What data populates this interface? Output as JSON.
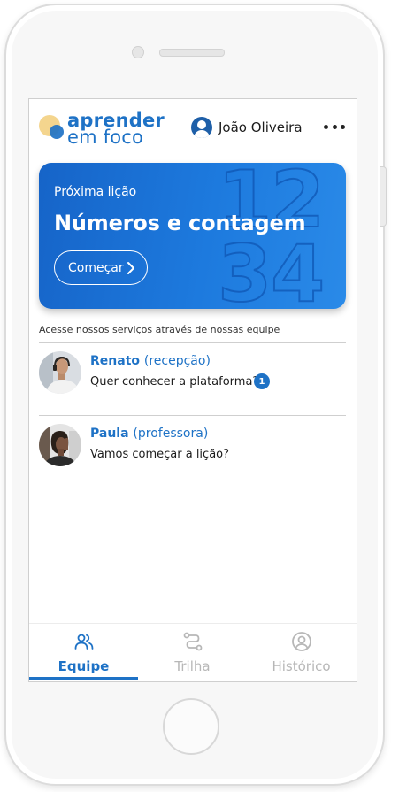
{
  "app": {
    "logo_line1": "aprender",
    "logo_line2": "em foco"
  },
  "header": {
    "user_name": "João Oliveira",
    "more_icon": "more-horizontal-icon"
  },
  "next_lesson": {
    "label": "Próxima lição",
    "title": "Números e contagem",
    "button_label": "Começar",
    "background_digits": [
      "1",
      "2",
      "3",
      "4"
    ]
  },
  "team_hint": "Acesse nossos serviços através de nossas equipe",
  "chats": [
    {
      "name": "Renato",
      "role": "(recepção)",
      "message": "Quer conhecer a plataforma?",
      "unread": "1"
    },
    {
      "name": "Paula",
      "role": "(professora)",
      "message": "Vamos começar a lição?"
    }
  ],
  "nav": {
    "tabs": [
      {
        "label": "Equipe",
        "icon": "users-icon",
        "active": true
      },
      {
        "label": "Trilha",
        "icon": "route-icon",
        "active": false
      },
      {
        "label": "Histórico",
        "icon": "user-circle-icon",
        "active": false
      }
    ]
  },
  "colors": {
    "brand_blue": "#1e72c6",
    "logo_yellow": "#f4d58e",
    "inactive_gray": "#b7b7b7"
  }
}
